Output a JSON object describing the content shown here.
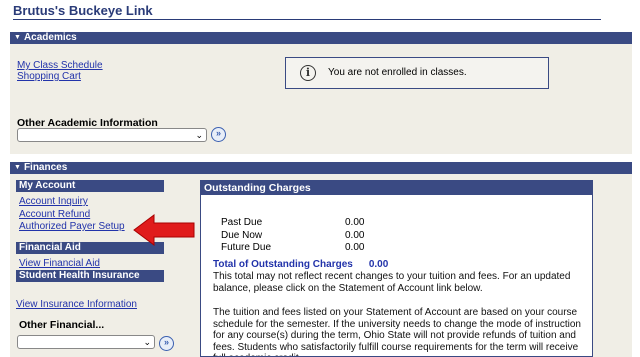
{
  "page": {
    "title": "Brutus's Buckeye Link"
  },
  "academics": {
    "header": "Academics",
    "links": [
      "My Class Schedule",
      "Shopping Cart"
    ],
    "notice": "You are not enrolled in classes.",
    "other_label": "Other Academic Information",
    "other_select_value": ""
  },
  "finances": {
    "header": "Finances",
    "my_account": {
      "header": "My Account",
      "links": [
        "Account Inquiry",
        "Account Refund",
        "Authorized Payer Setup"
      ]
    },
    "financial_aid": {
      "header": "Financial Aid",
      "links": [
        "View Financial Aid"
      ]
    },
    "student_health": {
      "header": "Student Health Insurance",
      "links": [
        "View Insurance Information"
      ]
    },
    "other_label": "Other Financial...",
    "other_select_value": "",
    "outstanding": {
      "header": "Outstanding Charges",
      "rows": [
        {
          "label": "Past Due",
          "value": "0.00"
        },
        {
          "label": "Due Now",
          "value": "0.00"
        },
        {
          "label": "Future Due",
          "value": "0.00"
        }
      ],
      "total_label": "Total of Outstanding Charges",
      "total_value": "0.00",
      "note": "This total may not reflect recent changes to your tuition and fees. For an updated balance, please click on the Statement of Account link below.",
      "policy": "The tuition and fees listed on your Statement of Account are based on your course schedule for the semester.  If the university needs to change the mode of instruction for any course(s) during the term, Ohio State will not provide refunds of tuition and fees. Students who satisfactorily fulfill course requirements for the term will receive full academic credit."
    }
  },
  "colors": {
    "header_bar": "#3a4a83",
    "panel_bg": "#f0eee6",
    "link": "#2233aa",
    "arrow": "#e01b1b"
  },
  "icons": {
    "info": "info-circle-icon",
    "go": "double-chevron-right-icon",
    "arrow": "red-arrow-pointer"
  }
}
